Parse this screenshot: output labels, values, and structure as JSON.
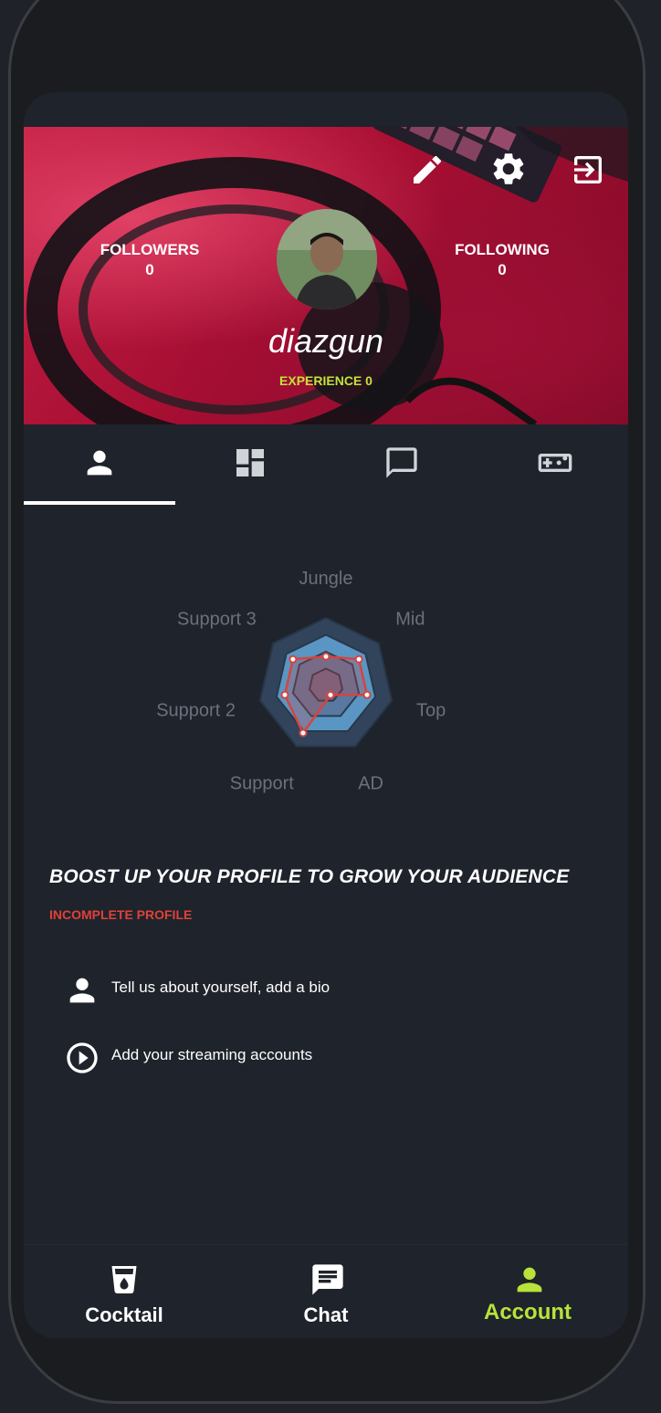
{
  "profile": {
    "followers_label": "FOLLOWERS",
    "followers_count": "0",
    "following_label": "FOLLOWING",
    "following_count": "0",
    "username": "diazgun",
    "experience": "EXPERIENCE 0"
  },
  "header_actions": {
    "edit_icon": "pencil-icon",
    "settings_icon": "gear-icon",
    "logout_icon": "exit-icon"
  },
  "tabs": [
    {
      "icon": "person-icon",
      "active": true
    },
    {
      "icon": "dashboard-icon",
      "active": false
    },
    {
      "icon": "chat-bubble-icon",
      "active": false
    },
    {
      "icon": "gamepad-icon",
      "active": false
    }
  ],
  "chart_data": {
    "type": "radar",
    "axes": [
      "Jungle",
      "Mid",
      "Top",
      "AD",
      "Support",
      "Support 2",
      "Support 3"
    ],
    "series": [
      {
        "values": [
          0.55,
          0.8,
          0.8,
          0.2,
          1.0,
          0.8,
          0.8
        ],
        "color": "#d4453f"
      }
    ],
    "background_levels": 4,
    "colors": {
      "outer_ring": "#32465e",
      "fill_ring": "#5d9bc9"
    }
  },
  "boost": {
    "title": "BOOST UP YOUR PROFILE TO GROW YOUR AUDIENCE",
    "status": "INCOMPLETE PROFILE",
    "items": [
      {
        "icon": "person-icon",
        "label": "Tell us about yourself, add a bio"
      },
      {
        "icon": "play-circle-icon",
        "label": "Add your streaming accounts"
      }
    ]
  },
  "bottom_nav": [
    {
      "icon": "cocktail-icon",
      "label": "Cocktail",
      "active": false
    },
    {
      "icon": "chat-icon",
      "label": "Chat",
      "active": false
    },
    {
      "icon": "account-icon",
      "label": "Account",
      "active": true
    }
  ],
  "colors": {
    "accent": "#b9e23a",
    "warning": "#e0413a",
    "background": "#1f232b"
  }
}
